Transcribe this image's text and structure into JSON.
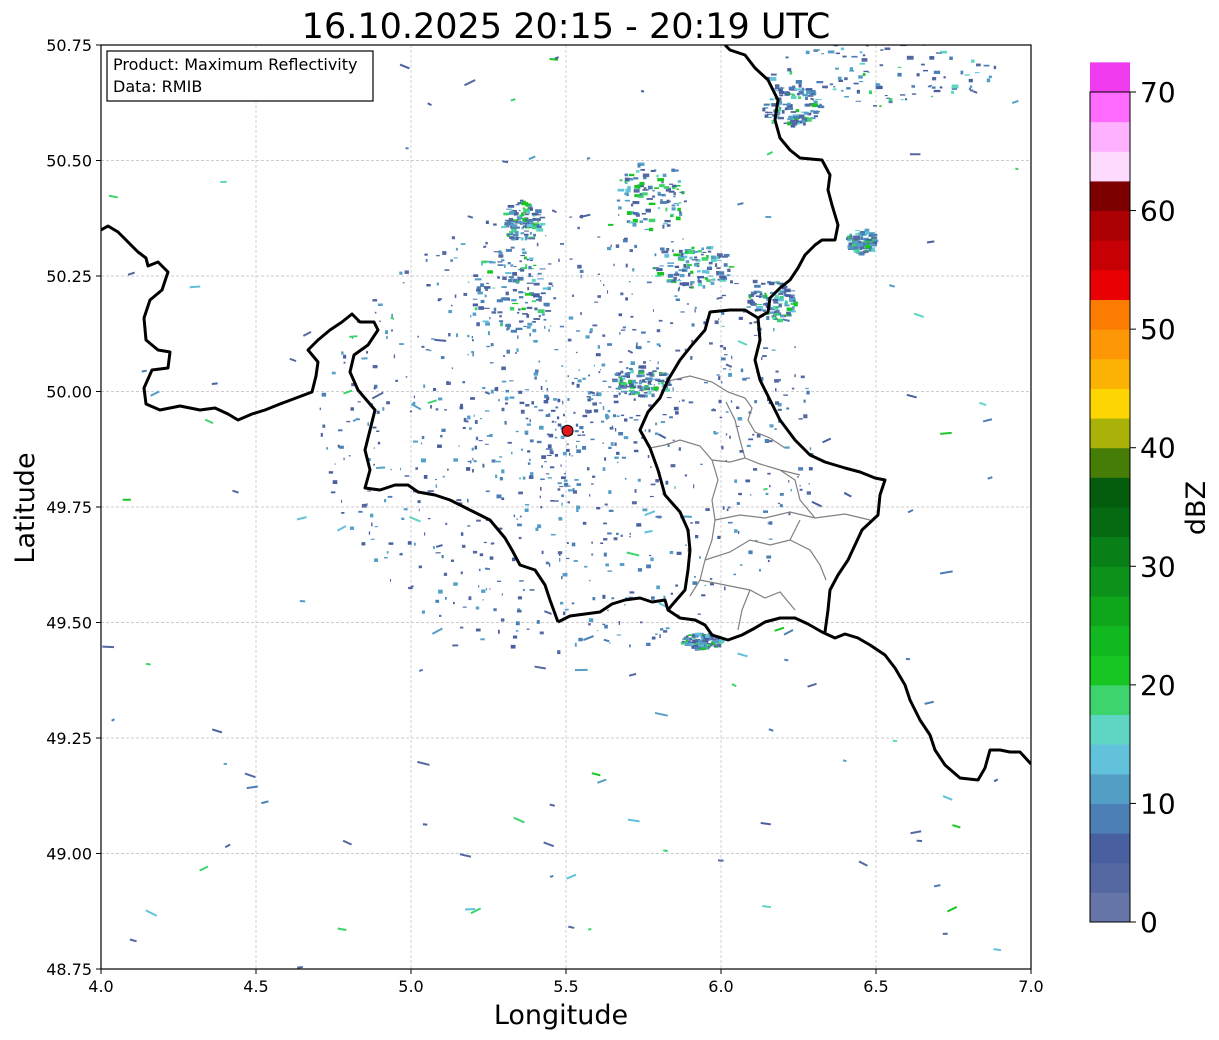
{
  "map": {
    "title": "16.10.2025 20:15 - 20:19 UTC",
    "xlabel": "Longitude",
    "ylabel": "Latitude",
    "info_lines": [
      "Product: Maximum Reflectivity",
      "Data: RMIB"
    ],
    "xlim": [
      4.0,
      7.0
    ],
    "ylim": [
      48.75,
      50.75
    ],
    "x_ticks": [
      "4.0",
      "4.5",
      "5.0",
      "5.5",
      "6.0",
      "6.5",
      "7.0"
    ],
    "y_ticks": [
      "48.75",
      "49.00",
      "49.25",
      "49.50",
      "49.75",
      "50.00",
      "50.25",
      "50.50",
      "50.75"
    ],
    "grid": true,
    "radar_site": {
      "lon": 5.505,
      "lat": 49.915,
      "color": "#e0191e"
    },
    "colorbar": {
      "label": "dBZ",
      "ticks": [
        "0",
        "10",
        "20",
        "30",
        "40",
        "50",
        "60",
        "70"
      ],
      "vmin": 0,
      "vmax": 70,
      "step": 2.5,
      "colors": [
        "#6676a8",
        "#5568a1",
        "#4860a0",
        "#4b7fb5",
        "#549fc6",
        "#63c2db",
        "#5fd6c4",
        "#3dd46e",
        "#17c622",
        "#11b81f",
        "#0fa61b",
        "#0c921a",
        "#097f17",
        "#056a12",
        "#045c0d",
        "#467d07",
        "#a9b209",
        "#fcd503",
        "#fbb205",
        "#fd9705",
        "#fb7c01",
        "#e80003",
        "#c60004",
        "#ac0003",
        "#7d0000",
        "#ffdaff",
        "#feb1fe",
        "#ff6bff",
        "#ef3bee"
      ]
    }
  }
}
